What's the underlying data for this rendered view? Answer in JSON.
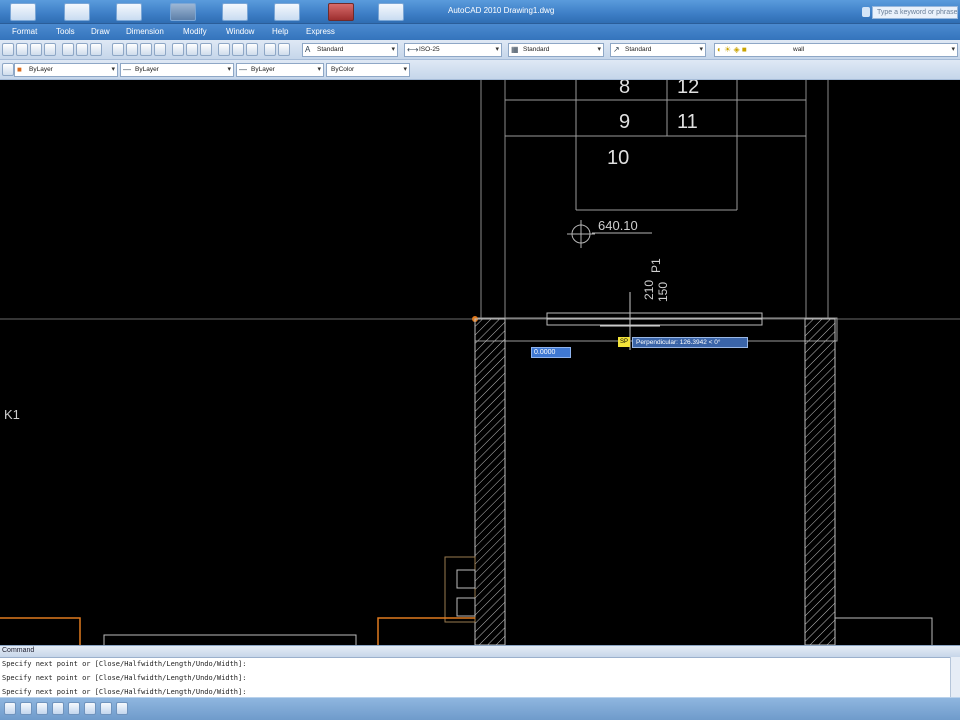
{
  "window": {
    "title": "AutoCAD 2010  Drawing1.dwg",
    "search_placeholder": "Type a keyword or phrase"
  },
  "menu": {
    "items": [
      "Format",
      "Tools",
      "Draw",
      "Dimension",
      "Modify",
      "Window",
      "Help",
      "Express"
    ]
  },
  "toolbar1": {
    "text_style": "Standard",
    "dim_style": "ISO-25",
    "table_style": "Standard",
    "multileader_style": "Standard",
    "layer": "wall"
  },
  "toolbar2": {
    "color": "ByLayer",
    "linetype": "ByLayer",
    "lineweight": "ByLayer",
    "plot_style": "ByColor"
  },
  "drawing": {
    "numbers": [
      "8",
      "12",
      "9",
      "11",
      "10"
    ],
    "elevation_label": "640.10",
    "vertical_label_1": "210",
    "vertical_label_2": "150",
    "vertical_label_3": "P1",
    "side_label": "K1",
    "colors": {
      "lines": "#d9d9d9",
      "orange": "#e07a1f",
      "hatch": "#cfcfcf"
    }
  },
  "dynamic_input": {
    "value": "0.0000",
    "snap_marker": "SP",
    "snap_tip": "Perpendicular: 126.3942 < 0°"
  },
  "command": {
    "tab_label": "Command",
    "history": [
      "Specify next point or [Close/Halfwidth/Length/Undo/Width]:",
      "Specify next point or [Close/Halfwidth/Length/Undo/Width]:",
      "Specify next point or [Close/Halfwidth/Length/Undo/Width]:"
    ]
  }
}
